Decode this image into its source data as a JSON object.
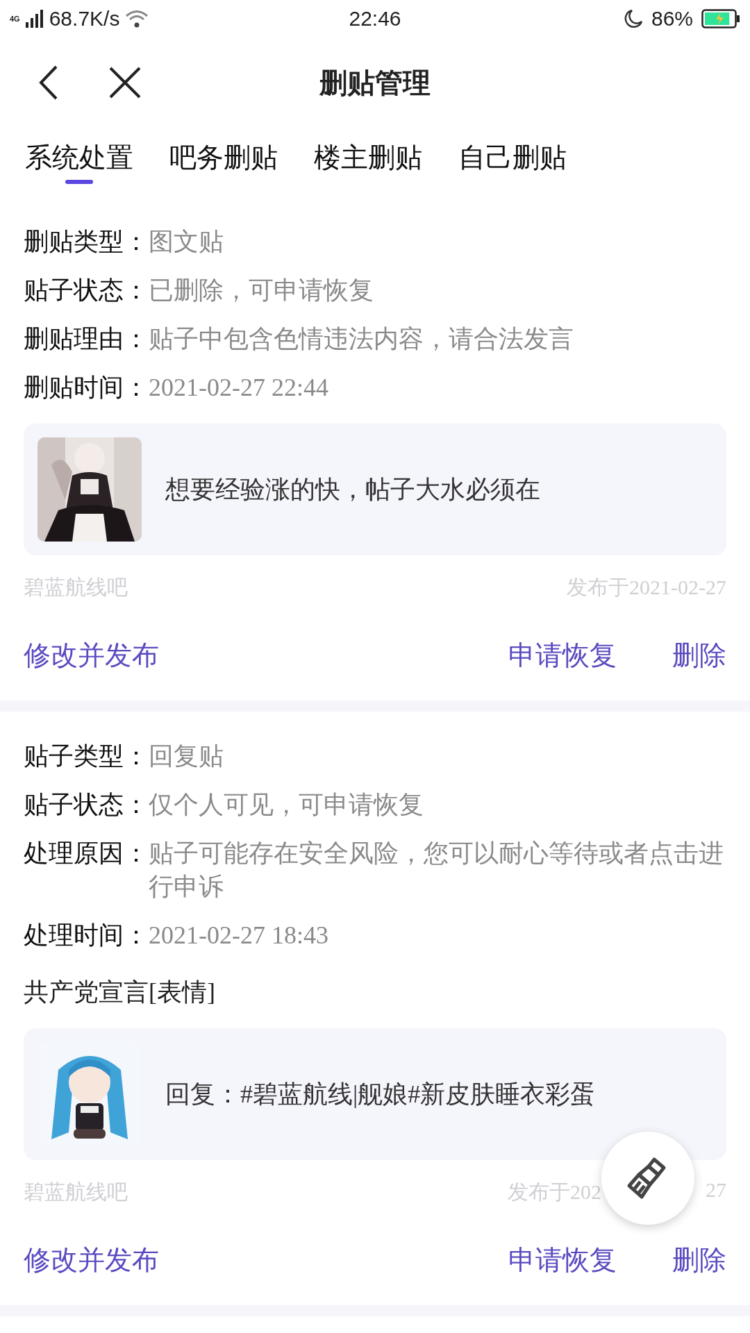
{
  "status_bar": {
    "network": "4G",
    "speed": "68.7K/s",
    "time": "22:46",
    "battery": "86%",
    "charging": true
  },
  "header": {
    "title": "删贴管理"
  },
  "tabs": [
    {
      "label": "系统处置",
      "selected": true
    },
    {
      "label": "吧务删贴",
      "selected": false
    },
    {
      "label": "楼主删贴",
      "selected": false
    },
    {
      "label": "自己删贴",
      "selected": false
    }
  ],
  "records": [
    {
      "fields": [
        {
          "label": "删贴类型：",
          "value": "图文贴"
        },
        {
          "label": "贴子状态：",
          "value": "已删除，可申请恢复"
        },
        {
          "label": "删贴理由：",
          "value": "贴子中包含色情违法内容，请合法发言"
        },
        {
          "label": "删贴时间：",
          "value": "2021-02-27 22:44"
        }
      ],
      "card": {
        "text": "想要经验涨的快，帖子大水必须在"
      },
      "forum": "碧蓝航线吧",
      "date": "发布于2021-02-27",
      "actions": [
        "修改并发布",
        "申请恢复",
        "删除"
      ]
    },
    {
      "fields": [
        {
          "label": "贴子类型：",
          "value": "回复贴"
        },
        {
          "label": "贴子状态：",
          "value": "仅个人可见，可申请恢复"
        },
        {
          "label": "处理原因：",
          "value": "贴子可能存在安全风险，您可以耐心等待或者点击进行申诉"
        },
        {
          "label": "处理时间：",
          "value": "2021-02-27 18:43"
        }
      ],
      "content": "共产党宣言[表情]",
      "card": {
        "text": "回复：#碧蓝航线|舰娘#新皮肤睡衣彩蛋"
      },
      "forum": "碧蓝航线吧",
      "date": "发布于202",
      "date_tail": "27",
      "actions": [
        "修改并发布",
        "申请恢复",
        "删除"
      ]
    }
  ]
}
